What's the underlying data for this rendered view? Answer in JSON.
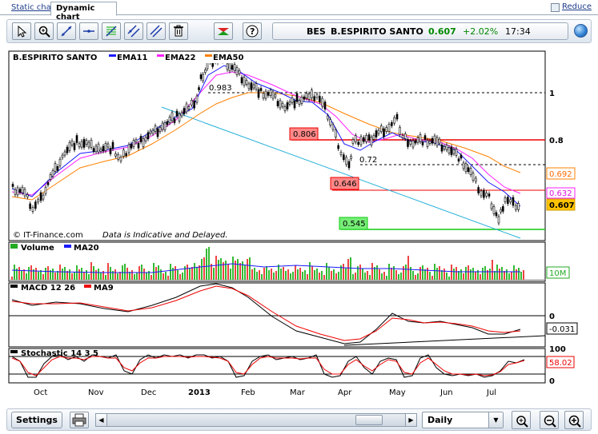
{
  "tabs": {
    "static_label": "Static chart",
    "dynamic_label": "Dynamic chart",
    "reduce_label": "Reduce"
  },
  "quote": {
    "symbol": "BES",
    "name": "B.ESPIRITO SANTO",
    "price": "0.607",
    "change": "+2.02%",
    "time": "17:34",
    "price_color": "#008800",
    "change_color": "#008800"
  },
  "toolbar_icons": [
    "cursor-icon",
    "zoom-icon",
    "trendline-icon",
    "horizontal-line-icon",
    "fibonacci-icon",
    "channel-icon",
    "parallel-icon",
    "trash-icon",
    "zigzag-icon",
    "help-icon"
  ],
  "legend": {
    "instrument": "B.ESPIRITO SANTO",
    "ema11": "EMA11",
    "ema22": "EMA22",
    "ema50": "EMA50",
    "ema11_color": "#1a1aff",
    "ema22_color": "#ff22ff",
    "ema50_color": "#ff8000",
    "copyright": "© IT-Finance.com",
    "disclaimer": "Data is Indicative and Delayed."
  },
  "annotations": {
    "level_0983": "0.983",
    "level_0806": "0.806",
    "level_072": "0.72",
    "level_0646": "0.646",
    "level_0545": "0.545"
  },
  "price_axis": {
    "tick_1": "1",
    "tick_08": "0.8",
    "ema50_value": "0.692",
    "ema22_value": "0.632",
    "last_value": "0.607"
  },
  "volume_panel": {
    "title_volume": "Volume",
    "title_ma": "MA20",
    "axis_label": "10M"
  },
  "macd_panel": {
    "title_macd": "MACD 12 26",
    "title_ma": "MA9",
    "tick_0": "0",
    "value": "-0.031"
  },
  "stoch_panel": {
    "title": "Stochastic 14 3 5",
    "tick_100": "100",
    "tick_0": "0",
    "value": "58.02"
  },
  "x_axis": [
    "Oct",
    "Nov",
    "Dec",
    "2013",
    "Feb",
    "Mar",
    "Apr",
    "May",
    "Jun",
    "Jul"
  ],
  "bottom": {
    "settings_label": "Settings",
    "period_value": "Daily"
  },
  "chart_data": {
    "type": "line",
    "title": "B.ESPIRITO SANTO",
    "ylabel": "",
    "ylim": [
      0.5,
      1.1
    ],
    "x": [
      "Oct",
      "Nov",
      "Dec",
      "2013",
      "Feb",
      "Mar",
      "Apr",
      "May",
      "Jun",
      "Jul"
    ],
    "series": [
      {
        "name": "B.ESPIRITO SANTO",
        "values": [
          0.64,
          0.72,
          0.78,
          0.98,
          0.96,
          0.9,
          0.72,
          0.85,
          0.74,
          0.61
        ]
      },
      {
        "name": "EMA11",
        "values": [
          0.63,
          0.71,
          0.77,
          0.96,
          0.95,
          0.9,
          0.76,
          0.82,
          0.75,
          0.63
        ]
      },
      {
        "name": "EMA22",
        "values": [
          0.62,
          0.7,
          0.76,
          0.94,
          0.94,
          0.9,
          0.78,
          0.81,
          0.77,
          0.632
        ]
      },
      {
        "name": "EMA50",
        "values": [
          0.6,
          0.67,
          0.73,
          0.88,
          0.91,
          0.9,
          0.82,
          0.8,
          0.78,
          0.692
        ]
      }
    ]
  }
}
